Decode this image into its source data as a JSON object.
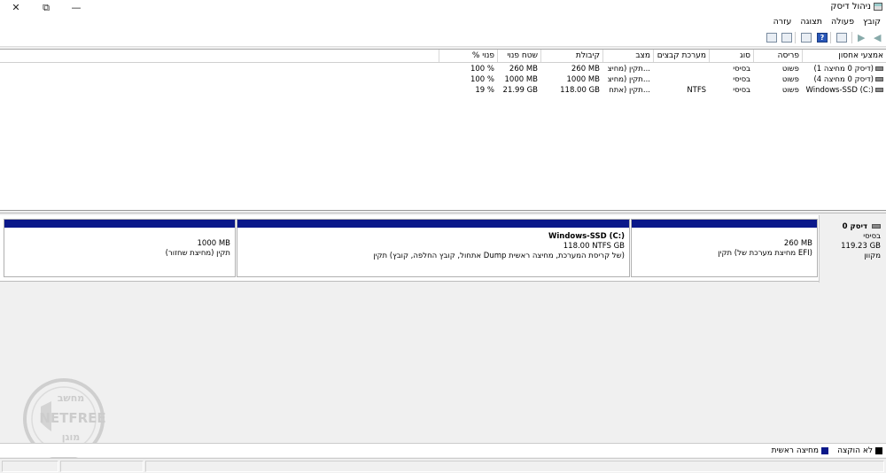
{
  "window": {
    "title": "ניהול דיסק",
    "controls": {
      "close": "✕",
      "restore": "⧉",
      "minimize": "—"
    }
  },
  "menu": [
    "קובץ",
    "פעולה",
    "תצוגה",
    "עזרה"
  ],
  "toolbar": {
    "help_glyph": "?"
  },
  "table": {
    "columns": [
      "אמצעי אחסון",
      "פריסה",
      "סוג",
      "מערכת קבצים",
      "מצב",
      "קיבולת",
      "שטח פנוי",
      "% פנוי"
    ],
    "rows": [
      [
        "(דיסק 0 מחיצה 1)",
        "פשוט",
        "בסיסי",
        "",
        "תקין (מחיצ...",
        "260 MB",
        "260 MB",
        "100 %"
      ],
      [
        "(דיסק 0 מחיצה 4)",
        "פשוט",
        "בסיסי",
        "",
        "תקין (מחיצ...",
        "1000 MB",
        "1000 MB",
        "100 %"
      ],
      [
        "Windows-SSD (C:)",
        "פשוט",
        "בסיסי",
        "NTFS",
        "תקין (אתח...",
        "118.00 GB",
        "21.99 GB",
        "19 %"
      ]
    ]
  },
  "disk": {
    "name": "דיסק 0",
    "type": "בסיסי",
    "size": "119.23 GB",
    "status": "מקוון",
    "partitions": [
      {
        "name": "",
        "size": "260 MB",
        "status": "תקין (מחיצת מערכת של EFI)"
      },
      {
        "name": "Windows-SSD  (C:)",
        "size": "118.00 NTFS GB",
        "status": "תקין (אתחול, קובץ החלפה, קובץ Dump של קריסת המערכת, מחיצה ראשית)"
      },
      {
        "name": "",
        "size": "1000 MB",
        "status": "תקין (מחיצת שחזור)"
      }
    ]
  },
  "legend": [
    {
      "label": "לא הוקצה",
      "color": "#000000"
    },
    {
      "label": "מחיצה ראשית",
      "color": "#0a188a"
    }
  ],
  "watermark": {
    "top": "מחשב",
    "middle": "NETFREE",
    "bottom": "מוגן"
  }
}
